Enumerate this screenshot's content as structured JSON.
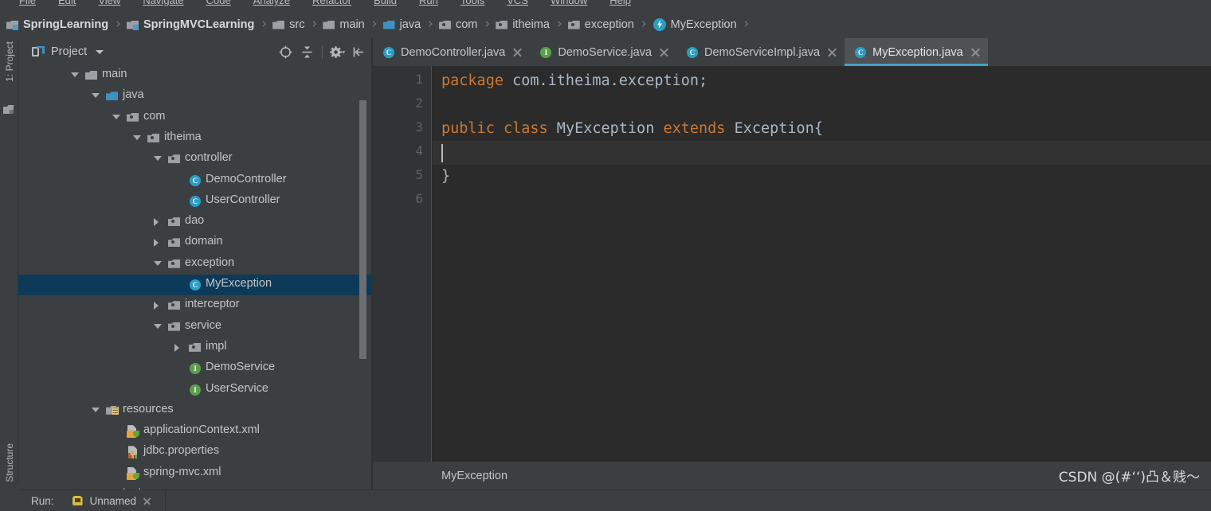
{
  "window": {
    "menu_items": [
      "File",
      "Edit",
      "View",
      "Navigate",
      "Code",
      "Analyze",
      "Refactor",
      "Build",
      "Run",
      "Tools",
      "VCS",
      "Window",
      "Help"
    ]
  },
  "breadcrumb": {
    "separator": "›",
    "items": [
      {
        "label": "SpringLearning",
        "icon": "module-icon",
        "bold": true
      },
      {
        "label": "SpringMVCLearning",
        "icon": "module-icon",
        "bold": true
      },
      {
        "label": "src",
        "icon": "folder-icon",
        "bold": false
      },
      {
        "label": "main",
        "icon": "folder-icon",
        "bold": false
      },
      {
        "label": "java",
        "icon": "source-folder-icon",
        "bold": false
      },
      {
        "label": "com",
        "icon": "package-icon",
        "bold": false
      },
      {
        "label": "itheima",
        "icon": "package-icon",
        "bold": false
      },
      {
        "label": "exception",
        "icon": "package-icon",
        "bold": false
      },
      {
        "label": "MyException",
        "icon": "exception-class-icon",
        "bold": false
      }
    ]
  },
  "left_toolstrip": {
    "top_tab": "1: Project",
    "bottom_tab": "Structure"
  },
  "project_panel": {
    "title": "Project",
    "title_icon": "project-view-icon",
    "dropdown_icon": "chevron-down-icon",
    "tools": [
      {
        "name": "scroll-from-source-icon",
        "label": ""
      },
      {
        "name": "collapse-all-icon",
        "label": ""
      },
      {
        "name": "settings-gear-icon",
        "label": ""
      },
      {
        "name": "hide-panel-icon",
        "label": ""
      }
    ],
    "tree": [
      {
        "label": "main",
        "indent": 0,
        "arrow": "down",
        "icon": "folder-icon",
        "selected": false
      },
      {
        "label": "java",
        "indent": 1,
        "arrow": "down",
        "icon": "source-folder-icon",
        "selected": false
      },
      {
        "label": "com",
        "indent": 2,
        "arrow": "down",
        "icon": "package-icon",
        "selected": false
      },
      {
        "label": "itheima",
        "indent": 3,
        "arrow": "down",
        "icon": "package-icon",
        "selected": false
      },
      {
        "label": "controller",
        "indent": 4,
        "arrow": "down",
        "icon": "package-icon",
        "selected": false
      },
      {
        "label": "DemoController",
        "indent": 5,
        "arrow": "none",
        "icon": "class-icon",
        "selected": false
      },
      {
        "label": "UserController",
        "indent": 5,
        "arrow": "none",
        "icon": "class-icon",
        "selected": false
      },
      {
        "label": "dao",
        "indent": 4,
        "arrow": "right",
        "icon": "package-icon",
        "selected": false
      },
      {
        "label": "domain",
        "indent": 4,
        "arrow": "right",
        "icon": "package-icon",
        "selected": false
      },
      {
        "label": "exception",
        "indent": 4,
        "arrow": "down",
        "icon": "package-icon",
        "selected": false
      },
      {
        "label": "MyException",
        "indent": 5,
        "arrow": "none",
        "icon": "class-icon",
        "selected": true
      },
      {
        "label": "interceptor",
        "indent": 4,
        "arrow": "right",
        "icon": "package-icon",
        "selected": false
      },
      {
        "label": "service",
        "indent": 4,
        "arrow": "down",
        "icon": "package-icon",
        "selected": false
      },
      {
        "label": "impl",
        "indent": 5,
        "arrow": "right",
        "icon": "package-icon",
        "selected": false
      },
      {
        "label": "DemoService",
        "indent": 5,
        "arrow": "none",
        "icon": "interface-icon",
        "selected": false
      },
      {
        "label": "UserService",
        "indent": 5,
        "arrow": "none",
        "icon": "interface-icon",
        "selected": false
      },
      {
        "label": "resources",
        "indent": 1,
        "arrow": "down",
        "icon": "resources-folder-icon",
        "selected": false
      },
      {
        "label": "applicationContext.xml",
        "indent": 2,
        "arrow": "none",
        "icon": "spring-xml-icon",
        "selected": false
      },
      {
        "label": "jdbc.properties",
        "indent": 2,
        "arrow": "none",
        "icon": "properties-icon",
        "selected": false
      },
      {
        "label": "spring-mvc.xml",
        "indent": 2,
        "arrow": "none",
        "icon": "spring-xml-icon",
        "selected": false
      },
      {
        "label": "test",
        "indent": 1,
        "arrow": "right",
        "icon": "folder-icon",
        "selected": false
      }
    ]
  },
  "editor": {
    "tabs": [
      {
        "label": "DemoController.java",
        "icon": "class-icon",
        "active": false
      },
      {
        "label": "DemoService.java",
        "icon": "interface-icon",
        "active": false
      },
      {
        "label": "DemoServiceImpl.java",
        "icon": "class-icon",
        "active": false
      },
      {
        "label": "MyException.java",
        "icon": "class-icon",
        "active": true
      }
    ],
    "line_numbers": [
      "1",
      "2",
      "3",
      "4",
      "5",
      "6"
    ],
    "caret_line": 4,
    "lines": [
      {
        "n": 1,
        "tokens": [
          {
            "t": "package",
            "c": "kw"
          },
          {
            "t": " com.itheima.exception;",
            "c": "txt"
          }
        ]
      },
      {
        "n": 2,
        "tokens": []
      },
      {
        "n": 3,
        "tokens": [
          {
            "t": "public",
            "c": "kw"
          },
          {
            "t": " ",
            "c": "txt"
          },
          {
            "t": "class",
            "c": "kw"
          },
          {
            "t": " MyException ",
            "c": "txt"
          },
          {
            "t": "extends",
            "c": "kw"
          },
          {
            "t": " Exception{",
            "c": "txt"
          }
        ]
      },
      {
        "n": 4,
        "tokens": []
      },
      {
        "n": 5,
        "tokens": [
          {
            "t": "}",
            "c": "txt"
          }
        ]
      },
      {
        "n": 6,
        "tokens": []
      }
    ],
    "status_label": "MyException",
    "watermark": "CSDN @(#ʻʻ)凸＆贱～"
  },
  "bottom_bar": {
    "run_label": "Run:",
    "run_config": "Unnamed",
    "run_icon": "spring-boot-run-icon",
    "close_icon": "close-icon"
  },
  "colors": {
    "chrome": "#3c3f41",
    "editor_bg": "#2b2b2b",
    "gutter_bg": "#313335",
    "selection": "#0d3a58",
    "accent": "#46a0c8",
    "keyword": "#cc7832",
    "text": "#a9b7c6"
  }
}
